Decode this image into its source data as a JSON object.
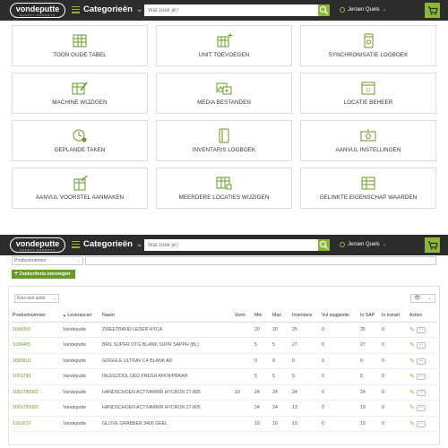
{
  "header": {
    "logo_text": "vondeputte",
    "logo_sub": "SAFETY EXPERTS",
    "categories_label": "Categorieën",
    "search_placeholder": "Wat zoek je?",
    "user_name": "Jeroen Quels",
    "accent_color": "#8cb83a"
  },
  "tiles": [
    {
      "label": "TOON OUDE TABEL",
      "icon": "table-icon"
    },
    {
      "label": "UNIT TOEVOEGEN",
      "icon": "add-table-icon"
    },
    {
      "label": "SYNCHRONISATIE LOGBOEK",
      "icon": "sync-log-icon"
    },
    {
      "label": "MACHINE WIJZIGEN",
      "icon": "machine-edit-icon"
    },
    {
      "label": "MEDIA BESTANDEN",
      "icon": "media-icon"
    },
    {
      "label": "LOCATIE BEHEER",
      "icon": "location-icon"
    },
    {
      "label": "GEPLANDE TAKEN",
      "icon": "scheduled-icon"
    },
    {
      "label": "INVENTARIS LOGBOEK",
      "icon": "inventory-log-icon"
    },
    {
      "label": "AANVUL INSTELLINGEN",
      "icon": "refill-settings-icon"
    },
    {
      "label": "AANVUL VOORSTEL AANMAKEN",
      "icon": "refill-proposal-icon"
    },
    {
      "label": "MEERDERE LOCATIES WIJZIGEN",
      "icon": "multi-location-icon"
    },
    {
      "label": "GELINKTE EIGENSCHAP WAARDEN",
      "icon": "linked-property-icon"
    }
  ],
  "filter": {
    "field_label": "Productnummer",
    "add_button": "Zoekcriteria toevoegen",
    "add_symbol": "+"
  },
  "table_tools": {
    "action_label": "Kies een actie",
    "view_icon": "eye-icon"
  },
  "table": {
    "columns": [
      "Productnummer",
      "Leverancier",
      "Naam",
      "Vorm",
      "Min",
      "Max",
      "Inventaris",
      "Vul suggestie",
      "In SAP",
      "In transit",
      "Acties"
    ],
    "rows": [
      [
        "1000310",
        "Vandeputte",
        "ZWEETBAND LEDER HYCA",
        "",
        "20",
        "20",
        "25",
        "0",
        "25",
        "0"
      ],
      [
        "1000405",
        "Vandeputte",
        "BRIL SUPER OTG BLANK SUPR SAPPH (BL)",
        "",
        "5",
        "5",
        "27",
        "0",
        "27",
        "0"
      ],
      [
        "1000610",
        "Vandeputte",
        "GOGGLE ULTRAV C4 BLANK AD",
        "",
        "0",
        "0",
        "0",
        "0",
        "0",
        "0"
      ],
      [
        "1001799",
        "Vandeputte",
        "INLEGZOOL DEO FRESH AFKNIPBAAR",
        "",
        "5",
        "5",
        "5",
        "0",
        "5",
        "0"
      ],
      [
        "1001785002",
        "Vandeputte",
        "HANDSCHOEN ACTIVARMR HYCRON 27-805",
        "10",
        "24",
        "24",
        "24",
        "0",
        "24",
        "0"
      ],
      [
        "1001785003",
        "Vandeputte",
        "HANDSCHOEN ACTIVARMR HYCRON 27-805",
        "",
        "24",
        "24",
        "13",
        "0",
        "19",
        "0"
      ],
      [
        "1001672",
        "Vandeputte",
        "GLOVE GRABBER 3400 GEEL",
        "",
        "10",
        "10",
        "10",
        "0",
        "10",
        "0"
      ]
    ],
    "sort_indicator": "▲"
  }
}
